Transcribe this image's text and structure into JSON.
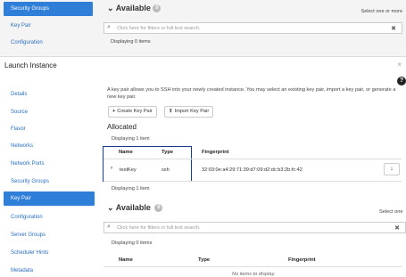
{
  "background": {
    "sidebar_items": [
      {
        "label": "Security Groups",
        "active": true
      },
      {
        "label": "Key Pair",
        "active": false
      },
      {
        "label": "Configuration",
        "active": false
      }
    ],
    "available_label": "Available",
    "available_badge": "0",
    "select_hint": "Select one or more",
    "filter_placeholder": "Click here for filters or full text search.",
    "displaying": "Displaying 0 items"
  },
  "modal": {
    "title": "Launch Instance",
    "close_glyph": "×",
    "help_glyph": "?",
    "sidebar_items": [
      {
        "label": "Details",
        "active": false
      },
      {
        "label": "Source",
        "active": false
      },
      {
        "label": "Flavor",
        "active": false
      },
      {
        "label": "Networks",
        "active": false
      },
      {
        "label": "Network Ports",
        "active": false
      },
      {
        "label": "Security Groups",
        "active": false
      },
      {
        "label": "Key Pair",
        "active": true
      },
      {
        "label": "Configuration",
        "active": false
      },
      {
        "label": "Server Groups",
        "active": false
      },
      {
        "label": "Scheduler Hints",
        "active": false
      },
      {
        "label": "Metadata",
        "active": false
      }
    ],
    "description": "A key pair allows you to SSH into your newly created instance. You may select an existing key pair, import a key pair, or generate a new key pair.",
    "create_button": "Create Key Pair",
    "import_button": "Import Key Pair",
    "allocated_heading": "Allocated",
    "allocated_displaying_top": "Displaying 1 item",
    "allocated_displaying_bottom": "Displaying 1 item",
    "allocated_columns": [
      "Name",
      "Type",
      "Fingerprint"
    ],
    "allocated_rows": [
      {
        "name": "testKey",
        "type": "ssh",
        "fingerprint": "32:03:0e:a4:29:71:39:d7:09:d2:dc:b3:2b:fc:42"
      }
    ],
    "available_heading": "Available",
    "available_badge": "0",
    "available_select_hint": "Select one",
    "filter_placeholder": "Click here for filters or full text search.",
    "available_displaying": "Displaying 0 items",
    "available_columns": [
      "Name",
      "Type",
      "Fingerprint"
    ],
    "no_items": "No items to display."
  }
}
